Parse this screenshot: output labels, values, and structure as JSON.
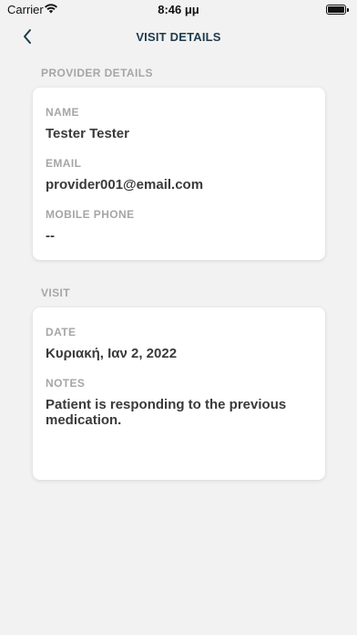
{
  "status_bar": {
    "carrier": "Carrier",
    "time": "8:46 μμ"
  },
  "nav": {
    "title": "VISIT DETAILS"
  },
  "provider_section": {
    "title": "PROVIDER DETAILS",
    "name_label": "NAME",
    "name_value": "Tester Tester",
    "email_label": "EMAIL",
    "email_value": "provider001@email.com",
    "phone_label": "MOBILE PHONE",
    "phone_value": "--"
  },
  "visit_section": {
    "title": "VISIT",
    "date_label": "DATE",
    "date_value": "Κυριακή, Ιαν 2, 2022",
    "notes_label": "NOTES",
    "notes_value": "Patient is responding to the previous medication."
  },
  "colors": {
    "accent": "#1f3b4d",
    "label": "#a6a6a6",
    "background": "#f2f2f2"
  }
}
